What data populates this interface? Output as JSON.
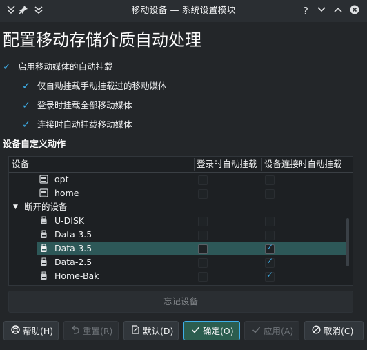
{
  "titlebar": {
    "title": "移动设备 — 系统设置模块",
    "left_icons": [
      "window-menu-icon",
      "pin-icon",
      "keep-below-icon"
    ],
    "right_buttons": {
      "help": "?",
      "minimize": "⌄",
      "maximize": "⌃",
      "close": "✕"
    }
  },
  "page": {
    "title": "配置移动存储介质自动处理"
  },
  "options": [
    {
      "label": "启用移动媒体的自动挂载",
      "checked": true
    },
    {
      "label": "仅自动挂载手动挂载过的移动媒体",
      "checked": true
    },
    {
      "label": "登录时挂载全部移动媒体",
      "checked": true
    },
    {
      "label": "连接时自动挂载移动媒体",
      "checked": true
    }
  ],
  "device_section": {
    "title": "设备自定义动作",
    "columns": [
      "设备",
      "登录时自动挂载",
      "设备连接时自动挂载"
    ],
    "rows": [
      {
        "type": "device",
        "icon": "hard-drive-icon",
        "label": "opt",
        "login": false,
        "attach": false
      },
      {
        "type": "device",
        "icon": "hard-drive-icon",
        "label": "home",
        "login": false,
        "attach": false
      },
      {
        "type": "group",
        "label": "断开的设备",
        "expanded": true
      },
      {
        "type": "device",
        "icon": "usb-drive-icon",
        "label": "U-DISK",
        "login": false,
        "attach": false
      },
      {
        "type": "device",
        "icon": "usb-drive-icon",
        "label": "Data-3.5",
        "login": false,
        "attach": false
      },
      {
        "type": "device",
        "icon": "usb-drive-icon",
        "label": "Data-3.5",
        "login": false,
        "attach": true,
        "selected": true
      },
      {
        "type": "device",
        "icon": "usb-drive-icon",
        "label": "Data-2.5",
        "login": false,
        "attach": true
      },
      {
        "type": "device",
        "icon": "usb-drive-icon",
        "label": "Home-Bak",
        "login": false,
        "attach": true
      }
    ],
    "forget_button": "忘记设备"
  },
  "buttons": {
    "help": "帮助(H)",
    "reset": "重置(R)",
    "defaults": "默认(D)",
    "ok": "确定(O)",
    "apply": "应用(A)",
    "cancel": "取消(C)"
  },
  "colors": {
    "background": "#232629",
    "accent": "#3daee9",
    "selection": "#2d5858"
  }
}
